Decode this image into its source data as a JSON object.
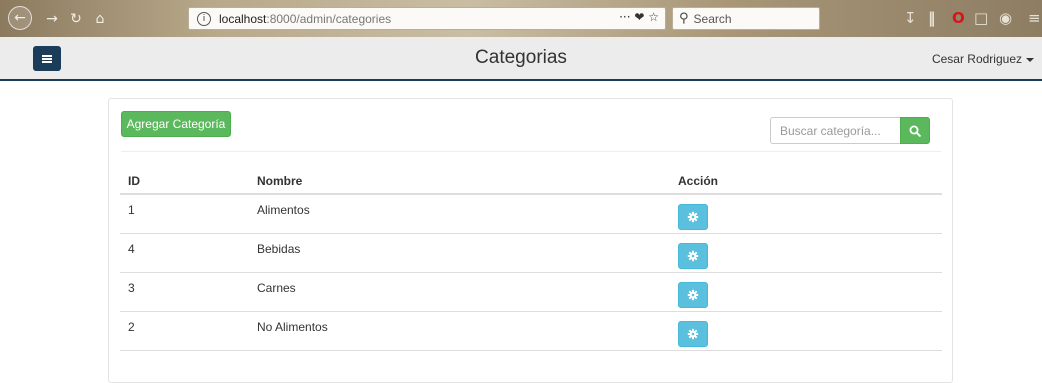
{
  "browser": {
    "url_prefix": "localhost",
    "url_rest": ":8000/admin/categories",
    "url_actions": "··· ❤ ☆",
    "search_placeholder": "Search"
  },
  "header": {
    "title": "Categorias",
    "user": "Cesar Rodriguez"
  },
  "panel": {
    "add_button": "Agregar Categoría",
    "search_placeholder": "Buscar categoría..."
  },
  "table": {
    "columns": [
      "ID",
      "Nombre",
      "Acción"
    ],
    "rows": [
      {
        "id": "1",
        "name": "Alimentos"
      },
      {
        "id": "4",
        "name": "Bebidas"
      },
      {
        "id": "3",
        "name": "Carnes"
      },
      {
        "id": "2",
        "name": "No Alimentos"
      }
    ]
  },
  "colors": {
    "success": "#5cb85c",
    "info": "#5bc0de",
    "navy": "#1b3d5a"
  },
  "icons": {
    "row_action": "gear-icon",
    "search": "search-icon",
    "menu": "hamburger-icon"
  }
}
